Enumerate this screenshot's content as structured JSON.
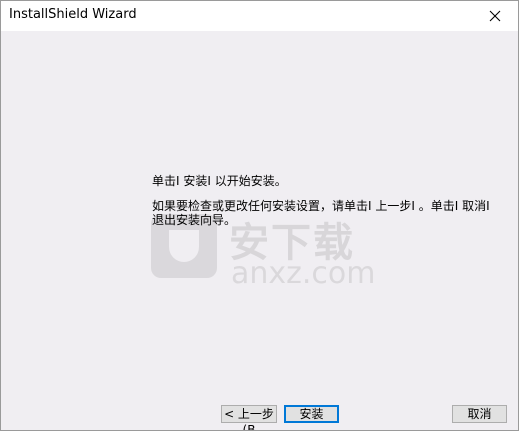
{
  "window": {
    "title": "InstallShield Wizard"
  },
  "icons": {
    "close": "close-icon"
  },
  "content": {
    "message_line1": "单击Ⅰ 安装Ⅰ 以开始安装。",
    "message_line2": "如果要检查或更改任何安装设置，请单击Ⅰ 上一步Ⅰ 。单击Ⅰ 取消Ⅰ 退出安装向导。"
  },
  "watermark": {
    "cn_text": "安下载",
    "en_text": "anxz.com"
  },
  "buttons": {
    "back_label": "< 上一步(B",
    "install_label": "安装",
    "cancel_label": "取消"
  }
}
